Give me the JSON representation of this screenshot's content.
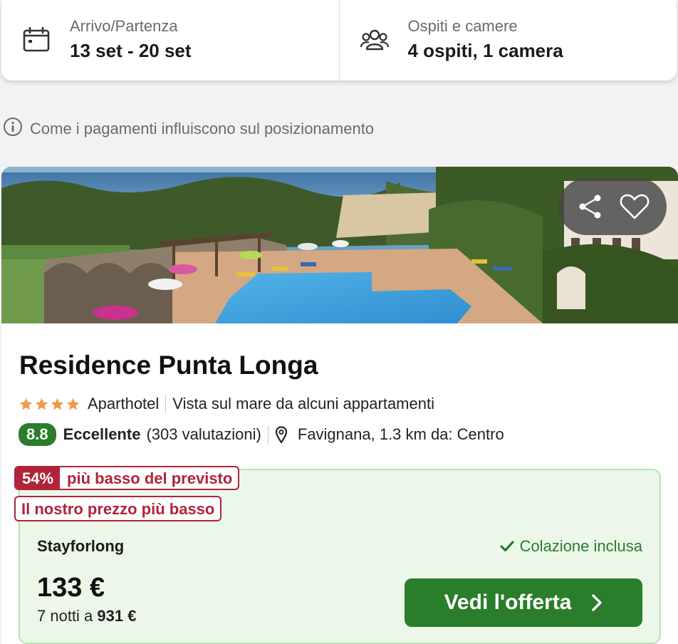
{
  "search": {
    "dates_label": "Arrivo/Partenza",
    "dates_value": "13 set - 20 set",
    "guests_label": "Ospiti e camere",
    "guests_value": "4 ospiti, 1 camera",
    "icons": [
      "calendar-icon",
      "people-icon"
    ]
  },
  "info": {
    "text": "Come i pagamenti influiscono sul posizionamento",
    "icon": "info-icon"
  },
  "hotel": {
    "name": "Residence Punta Longa",
    "stars": 4,
    "type": "Aparthotel",
    "feature": "Vista sul mare da alcuni appartamenti",
    "rating": "8.8",
    "rating_word": "Eccellente",
    "reviews": "(303 valutazioni)",
    "location": "Favignana, 1.3 km da: Centro",
    "photo_actions": [
      "share-icon",
      "heart-icon"
    ]
  },
  "deal": {
    "discount_pct": "54%",
    "discount_text": "più basso del previsto",
    "lowest_text": "Il nostro prezzo più basso",
    "provider": "Stayforlong",
    "breakfast": "Colazione inclusa",
    "price": "133 €",
    "nights_text": "7 notti a",
    "total": "931 €",
    "cta_label": "Vedi l'offerta"
  },
  "colors": {
    "accent_green": "#2a7d2a",
    "deal_background": "#ecf7ea",
    "discount_red": "#b0243a",
    "star_orange": "#f2994a"
  }
}
